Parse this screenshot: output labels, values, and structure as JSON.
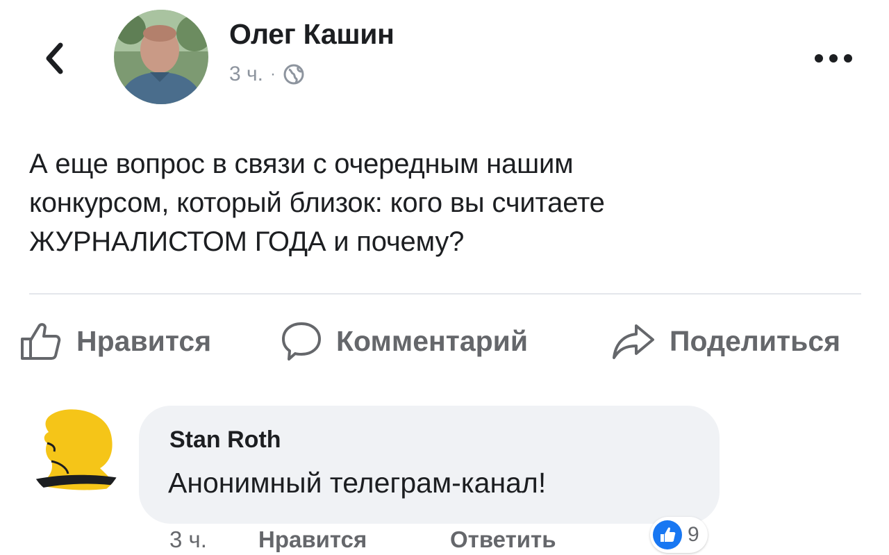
{
  "header": {
    "author_name": "Олег Кашин",
    "time": "3 ч.",
    "separator": "·",
    "privacy_icon": "globe-icon",
    "back_icon": "chevron-left-icon",
    "more_icon": "more-dots-icon"
  },
  "post": {
    "lines": [
      "А еще вопрос в связи с очередным нашим",
      "конкурсом, который близок: кого вы считаете",
      "ЖУРНАЛИСТОМ ГОДА и почему?"
    ]
  },
  "actions": {
    "like_label": "Нравится",
    "comment_label": "Комментарий",
    "share_label": "Поделиться"
  },
  "comment": {
    "author": "Stan Roth",
    "text": "Анонимный телеграм-канал!",
    "time": "3 ч.",
    "like_label": "Нравится",
    "reply_label": "Ответить",
    "reaction_count": "9"
  },
  "colors": {
    "brand_blue": "#1877f2",
    "secondary_text": "#65676b",
    "bubble_bg": "#f0f2f5",
    "avatar_yellow": "#f5c518"
  }
}
